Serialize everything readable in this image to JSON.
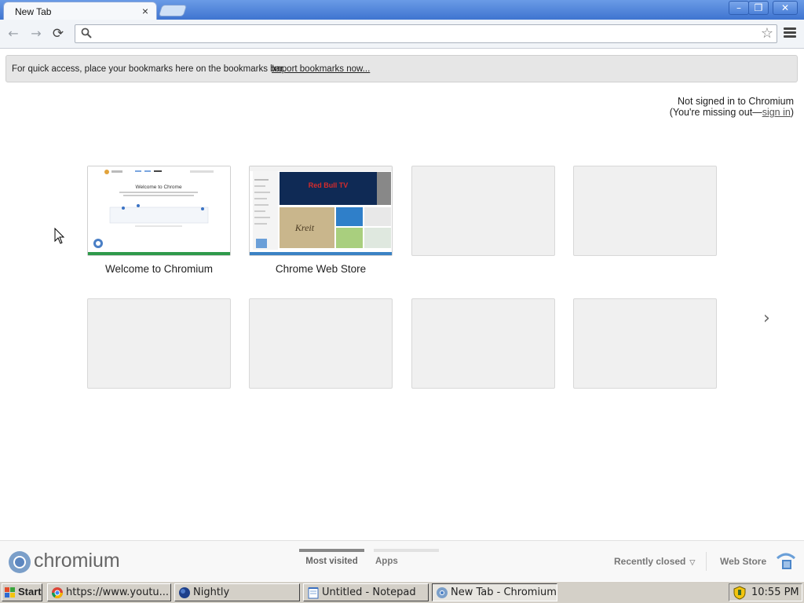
{
  "tabs": [
    {
      "title": "New Tab",
      "close": "×"
    }
  ],
  "window_controls": {
    "minimize": "–",
    "restore": "❐",
    "close": "✕"
  },
  "toolbar": {
    "back": "←",
    "forward": "→",
    "reload": "⟳",
    "omnibox_value": "",
    "omnibox_placeholder": "",
    "star": "☆"
  },
  "bookmark_bar": {
    "message": "For quick access, place your bookmarks here on the bookmarks bar.",
    "import_link": "Import bookmarks now..."
  },
  "signin": {
    "line1": "Not signed in to Chromium",
    "line2_prefix": "(You're missing out—",
    "link": "sign in",
    "line2_suffix": ")"
  },
  "most_visited": {
    "tiles": [
      {
        "label": "Welcome to Chromium",
        "has_thumb": true,
        "accent": "#2e9a4a"
      },
      {
        "label": "Chrome Web Store",
        "has_thumb": true,
        "accent": "#3b82c4"
      },
      {
        "label": "",
        "has_thumb": false
      },
      {
        "label": "",
        "has_thumb": false
      },
      {
        "label": "",
        "has_thumb": false
      },
      {
        "label": "",
        "has_thumb": false
      },
      {
        "label": "",
        "has_thumb": false
      },
      {
        "label": "",
        "has_thumb": false
      }
    ],
    "next": "›"
  },
  "thumb_welcome": {
    "heading": "Welcome to Chrome"
  },
  "thumb_store": {
    "banner": "Red Bull TV",
    "feature": "Kreit"
  },
  "footer": {
    "brand": "chromium",
    "sections": [
      {
        "label": "Most visited",
        "active": true
      },
      {
        "label": "Apps",
        "active": false
      }
    ],
    "recently_closed": "Recently closed",
    "caret": "▽",
    "web_store": "Web Store"
  },
  "taskbar": {
    "start": "Start",
    "tasks": [
      {
        "label": "https://www.youtu...",
        "active": false
      },
      {
        "label": "Nightly",
        "active": false
      },
      {
        "label": "Untitled - Notepad",
        "active": false
      },
      {
        "label": "New Tab - Chromium",
        "active": true
      }
    ],
    "clock": "10:55 PM"
  },
  "colors": {
    "titlebar": "#3f74d0",
    "accent_green": "#2e9a4a",
    "accent_blue": "#3b82c4"
  }
}
